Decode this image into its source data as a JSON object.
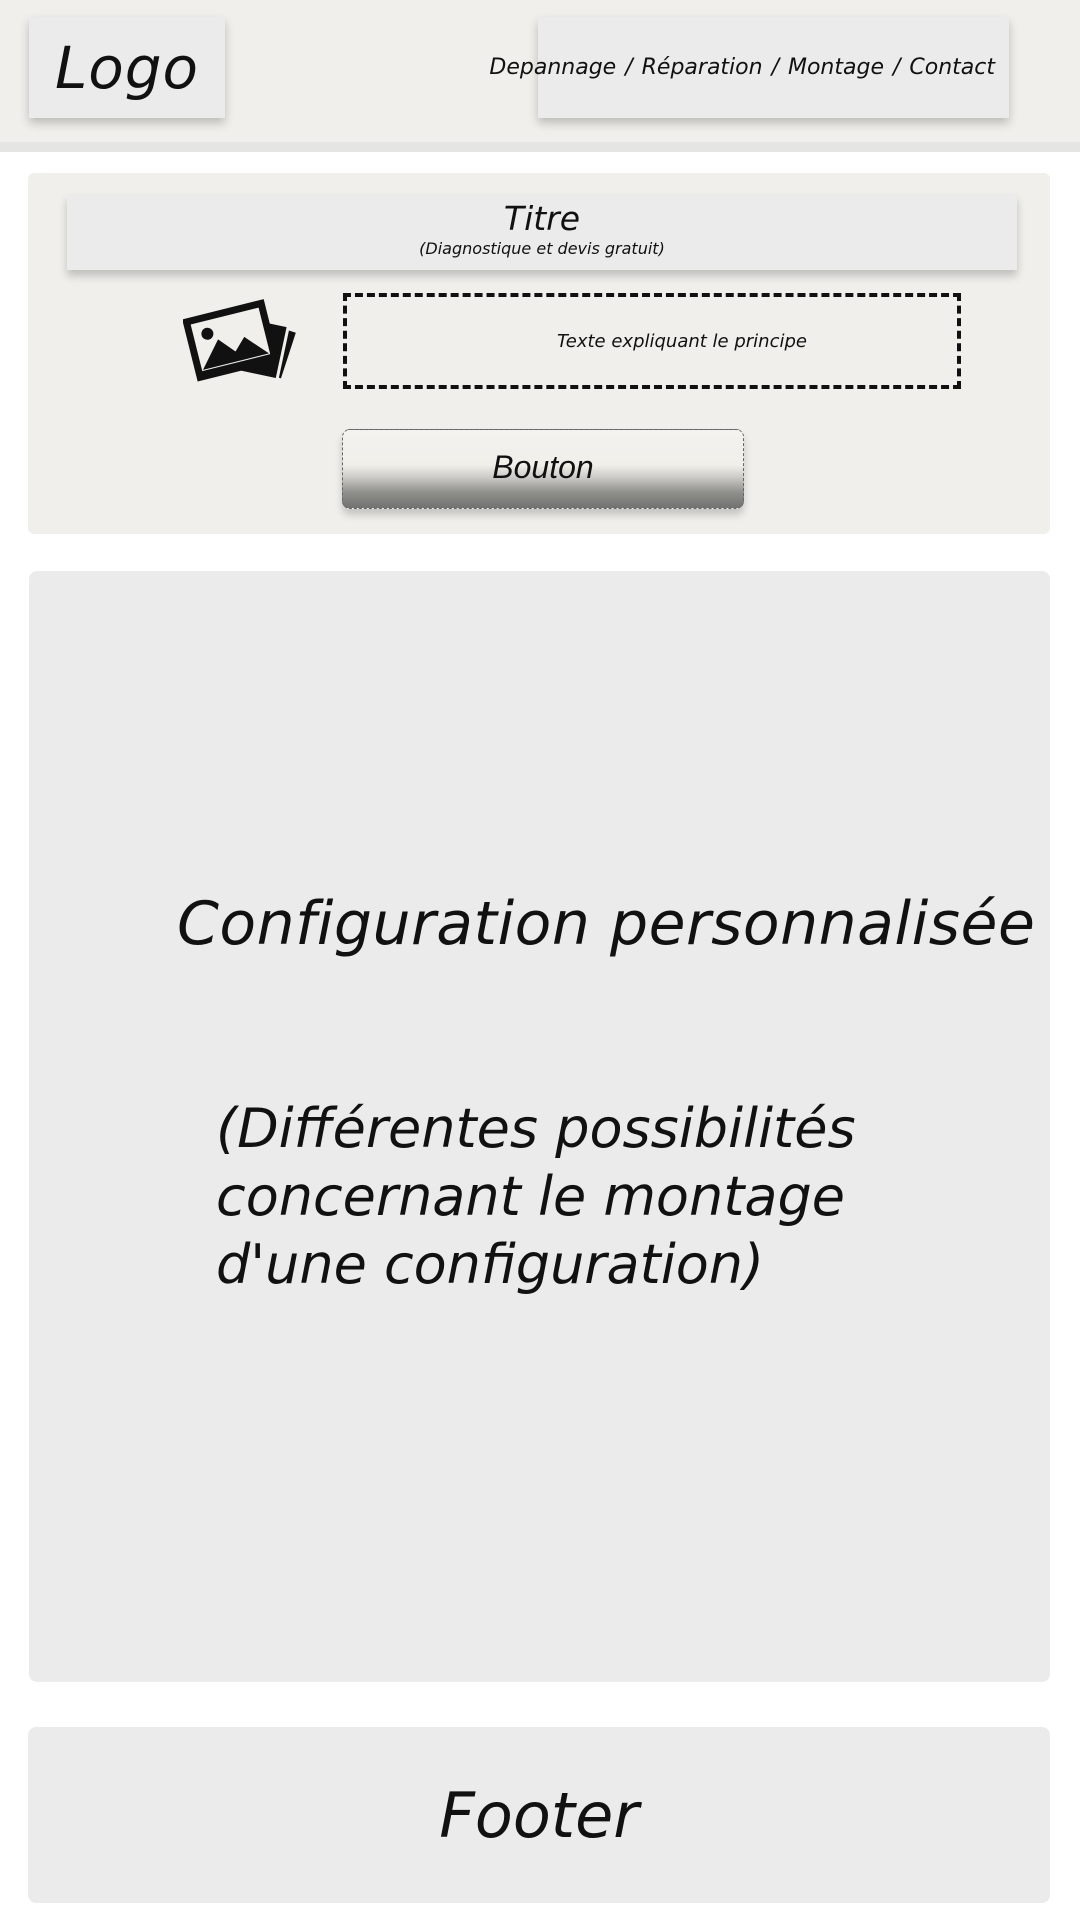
{
  "header": {
    "logo": "Logo",
    "nav": {
      "items": [
        "Depannage",
        "Réparation",
        "Montage",
        "Contact"
      ],
      "separator": "/"
    }
  },
  "hero": {
    "title": "Titre",
    "subtitle": "(Diagnostique et devis gratuit)",
    "image_icon": "photos-icon",
    "principle_text": "Texte expliquant le principe",
    "button_label": "Bouton"
  },
  "content": {
    "heading": "Configuration personnalisée",
    "description": "(Différentes possibilités concernant le montage d'une configuration)"
  },
  "footer": {
    "label": "Footer"
  },
  "colors": {
    "topbar_bg": "#f0efeb",
    "box_bg": "#ebebeb",
    "text": "#111111"
  }
}
